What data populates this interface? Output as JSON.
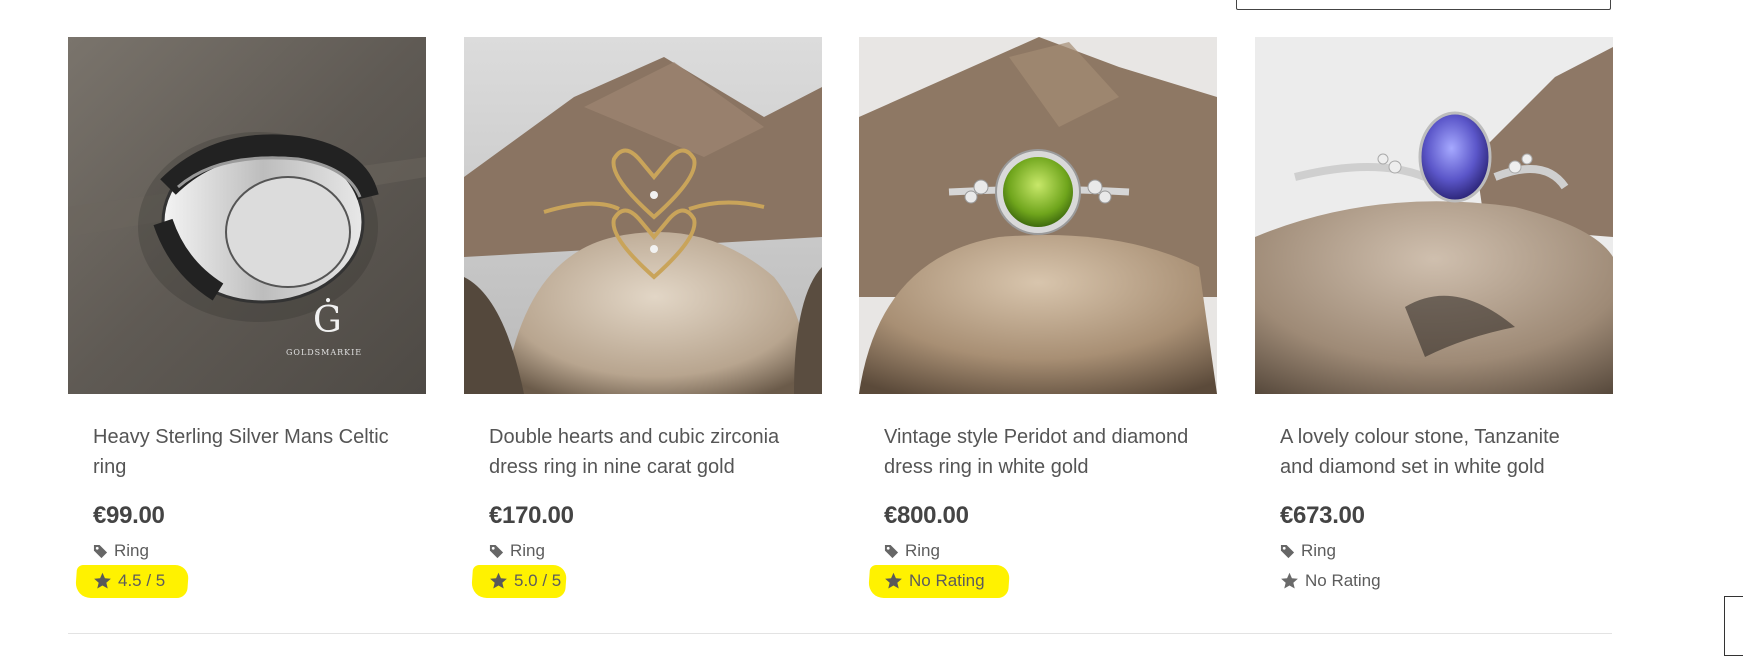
{
  "products": [
    {
      "title": "Heavy Sterling Silver Mans Celtic ring",
      "price": "€99.00",
      "category": "Ring",
      "rating": "4.5 / 5",
      "highlighted": true,
      "brand_mark": "Ġ",
      "brand_text": "GOLDSMARKIE"
    },
    {
      "title": "Double hearts and cubic zirconia dress ring in nine carat gold",
      "price": "€170.00",
      "category": "Ring",
      "rating": "5.0 / 5",
      "highlighted": true
    },
    {
      "title": "Vintage style Peridot and diamond dress ring in white gold",
      "price": "€800.00",
      "category": "Ring",
      "rating": "No Rating",
      "highlighted": true
    },
    {
      "title": "A lovely colour stone, Tanzanite and diamond set in white gold",
      "price": "€673.00",
      "category": "Ring",
      "rating": "No Rating",
      "highlighted": false
    }
  ],
  "icons": {
    "category": "tag-icon",
    "rating": "star-icon"
  },
  "colors": {
    "highlight": "#fff200",
    "text": "#5b5b5b",
    "price": "#444444"
  }
}
